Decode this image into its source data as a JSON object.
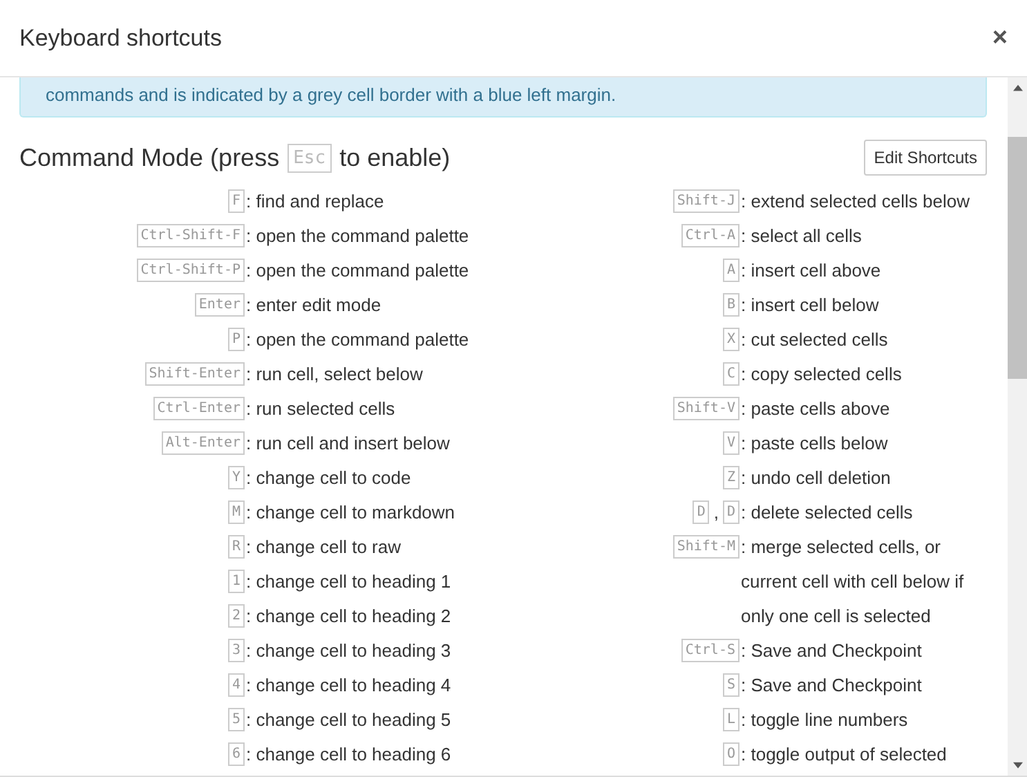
{
  "dialog": {
    "title": "Keyboard shortcuts",
    "close_label": "×"
  },
  "info_text": "commands and is indicated by a grey cell border with a blue left margin.",
  "section": {
    "title_before": "Command Mode (press",
    "key": "Esc",
    "title_after": "to enable)",
    "button": "Edit Shortcuts"
  },
  "columns": [
    {
      "shortcuts": [
        {
          "keys": [
            "F"
          ],
          "description": ": find and replace"
        },
        {
          "keys": [
            "Ctrl-Shift-F"
          ],
          "description": ": open the command palette"
        },
        {
          "keys": [
            "Ctrl-Shift-P"
          ],
          "description": ": open the command palette"
        },
        {
          "keys": [
            "Enter"
          ],
          "description": ": enter edit mode"
        },
        {
          "keys": [
            "P"
          ],
          "description": ": open the command palette"
        },
        {
          "keys": [
            "Shift-Enter"
          ],
          "description": ": run cell, select below"
        },
        {
          "keys": [
            "Ctrl-Enter"
          ],
          "description": ": run selected cells"
        },
        {
          "keys": [
            "Alt-Enter"
          ],
          "description": ": run cell and insert below"
        },
        {
          "keys": [
            "Y"
          ],
          "description": ": change cell to code"
        },
        {
          "keys": [
            "M"
          ],
          "description": ": change cell to markdown"
        },
        {
          "keys": [
            "R"
          ],
          "description": ": change cell to raw"
        },
        {
          "keys": [
            "1"
          ],
          "description": ": change cell to heading 1"
        },
        {
          "keys": [
            "2"
          ],
          "description": ": change cell to heading 2"
        },
        {
          "keys": [
            "3"
          ],
          "description": ": change cell to heading 3"
        },
        {
          "keys": [
            "4"
          ],
          "description": ": change cell to heading 4"
        },
        {
          "keys": [
            "5"
          ],
          "description": ": change cell to heading 5"
        },
        {
          "keys": [
            "6"
          ],
          "description": ": change cell to heading 6"
        }
      ]
    },
    {
      "shortcuts": [
        {
          "keys": [
            "Shift-J"
          ],
          "description": ": extend selected cells below"
        },
        {
          "keys": [
            "Ctrl-A"
          ],
          "description": ": select all cells"
        },
        {
          "keys": [
            "A"
          ],
          "description": ": insert cell above"
        },
        {
          "keys": [
            "B"
          ],
          "description": ": insert cell below"
        },
        {
          "keys": [
            "X"
          ],
          "description": ": cut selected cells"
        },
        {
          "keys": [
            "C"
          ],
          "description": ": copy selected cells"
        },
        {
          "keys": [
            "Shift-V"
          ],
          "description": ": paste cells above"
        },
        {
          "keys": [
            "V"
          ],
          "description": ": paste cells below"
        },
        {
          "keys": [
            "Z"
          ],
          "description": ": undo cell deletion"
        },
        {
          "keys": [
            "D",
            "D"
          ],
          "separator": ",",
          "description": ": delete selected cells"
        },
        {
          "keys": [
            "Shift-M"
          ],
          "description": ": merge selected cells, or current cell with cell below if only one cell is selected"
        },
        {
          "keys": [
            "Ctrl-S"
          ],
          "description": ": Save and Checkpoint"
        },
        {
          "keys": [
            "S"
          ],
          "description": ": Save and Checkpoint"
        },
        {
          "keys": [
            "L"
          ],
          "description": ": toggle line numbers"
        },
        {
          "keys": [
            "O"
          ],
          "description": ": toggle output of selected"
        }
      ]
    }
  ]
}
